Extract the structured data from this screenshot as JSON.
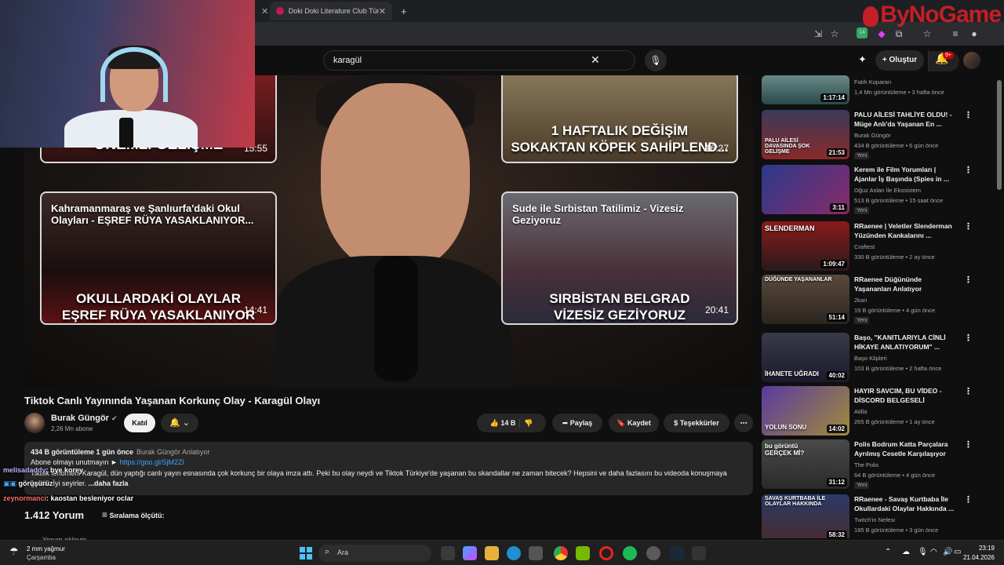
{
  "browser": {
    "tabs": [
      {
        "title": "Doki Doki Literature Club Türkçe"
      }
    ],
    "new_tab": "+",
    "badge_count": "14"
  },
  "overlay": {
    "watermark": "ByNoGame"
  },
  "header": {
    "search_query": "karagül",
    "create_label": "Oluştur",
    "notifications_badge": "9+"
  },
  "player": {
    "endcards": [
      {
        "big": "ÖNEMLİ GELİŞME",
        "duration": "15:55"
      },
      {
        "big": "1 HAFTALIK DEĞİŞİM\nSOKAKTAN KÖPEK SAHİPLEND...",
        "duration": "16:27"
      },
      {
        "title": "Kahramanmaraş ve Şanlıurfa'daki Okul Olayları - EŞREF RÜYA YASAKLANIYOR...",
        "big": "OKULLARDAKİ OLAYLAR\nEŞREF RÜYA YASAKLANIYOR",
        "duration": "14:41"
      },
      {
        "title": "Sude ile Sırbistan Tatilimiz - Vizesiz Geziyoruz",
        "big": "SIRBİSTAN BELGRAD\nVİZESİZ GEZİYORUZ",
        "duration": "20:41"
      }
    ]
  },
  "video": {
    "title": "Tiktok Canlı Yayınında Yaşanan Korkunç Olay - Karagül Olayı",
    "channel": "Burak Güngör",
    "subscribers": "2,26 Mn abone",
    "join_label": "Katıl",
    "likes": "14 B",
    "share_label": "Paylaş",
    "save_label": "Kaydet",
    "thanks_label": "Teşekkürler",
    "more_label": "⋯"
  },
  "description": {
    "stats": "434 B görüntüleme  1 gün önce",
    "hashtag": "Burak Güngör Anlatıyor",
    "line1_prefix": "Abone olmayı unutmayın  ► ",
    "link": "https://goo.gl/SjM2ZI",
    "body": "Tiktok fenomeni Karagül, dün yaptığı canlı yayın esnasında çok korkunç bir olaya imza attı. Peki bu olay neydi ve Tiktok Türkiye'de yaşanan bu skandallar ne zaman bitecek? Hepsini ve daha fazlasını bu videoda konuşmaya",
    "body2": "geldik. İyi seyirler. ",
    "more": "...daha fazla"
  },
  "chat": [
    {
      "user": "melisadaddy",
      "message": ": bye korey"
    },
    {
      "user": "",
      "message": "görüşürüz"
    },
    {
      "user": "zeynormanci",
      "message": ": kaostan besleniyor oclar"
    }
  ],
  "comments": {
    "count": "1.412 Yorum",
    "sort_label": "Sıralama ölçütü:",
    "add_placeholder": "Yorum ekleyin..."
  },
  "sidebar": {
    "items": [
      {
        "title": "",
        "channel": "Fatih Koparan",
        "meta": "1,4 Mn görüntüleme • 3 hafta önce",
        "duration": "1:17:14",
        "new": "",
        "thumb_label": ""
      },
      {
        "title": "PALU AİLESİ TAHLİYE OLDU! - Müge Anlı'da Yaşanan En ...",
        "channel": "Burak Güngör",
        "meta": "434 B görüntüleme • 6 gün önce",
        "duration": "21:53",
        "new": "Yeni",
        "thumb_label": "PALU AİLESİ DAVASINDA ŞOK GELİŞME"
      },
      {
        "title": "Kerem ile Film Yorumları | Ajanlar İş Başında (Spies in ...",
        "channel": "Oğuz Aslan İle Ekosistem",
        "meta": "513 B görüntüleme • 15 saat önce",
        "duration": "3:11",
        "new": "Yeni",
        "thumb_label": ""
      },
      {
        "title": "RRaenee | Veletler Slenderman Yüzünden Kankalarını ...",
        "channel": "Craftest",
        "meta": "330 B görüntüleme • 2 ay önce",
        "duration": "1:09:47",
        "new": "",
        "thumb_label": "SLENDERMAN"
      },
      {
        "title": "RRaenee Düğününde Yaşananları Anlatıyor",
        "channel": "2kan",
        "meta": "19 B görüntüleme • 4 gün önce",
        "duration": "51:14",
        "new": "Yeni",
        "thumb_label": "DÜĞÜNDE YAŞANANLAR"
      },
      {
        "title": "Başo, \"KANITLARIYLA CİNLİ HİKAYE ANLATIYORUM\" ...",
        "channel": "Başo Klipleri",
        "meta": "103 B görüntüleme • 2 hafta önce",
        "duration": "40:02",
        "new": "",
        "thumb_label": "İHANETE UĞRADI"
      },
      {
        "title": "HAYIR SAVCIM, BU VİDEO - DİSCORD BELGESELİ",
        "channel": "Atilla",
        "meta": "265 B görüntüleme • 1 ay önce",
        "duration": "14:02",
        "new": "",
        "thumb_label": "YOLUN SONU"
      },
      {
        "title": "Polis Bodrum Katta Parçalara Ayrılmış Cesetle Karşılaşıyor",
        "channel": "The Polis",
        "meta": "64 B görüntüleme • 4 gün önce",
        "duration": "31:12",
        "new": "Yeni",
        "thumb_label": "bu görüntü GERÇEK Mİ?"
      },
      {
        "title": "RRaenee - Savaş Kurtbaba İle Okullardaki Olaylar Hakkında ...",
        "channel": "Twitch'in Nefesi",
        "meta": "185 B görüntüleme • 3 gün önce",
        "duration": "58:32",
        "new": "",
        "thumb_label": "SAVAŞ KURTBABA İLE OLAYLAR HAKKINDA"
      }
    ]
  },
  "taskbar": {
    "weather_temp": "2 mm yağmur",
    "weather_day": "Çarşamba",
    "search_label": "Ara",
    "time": "23:19",
    "date": "21.04.2026"
  }
}
